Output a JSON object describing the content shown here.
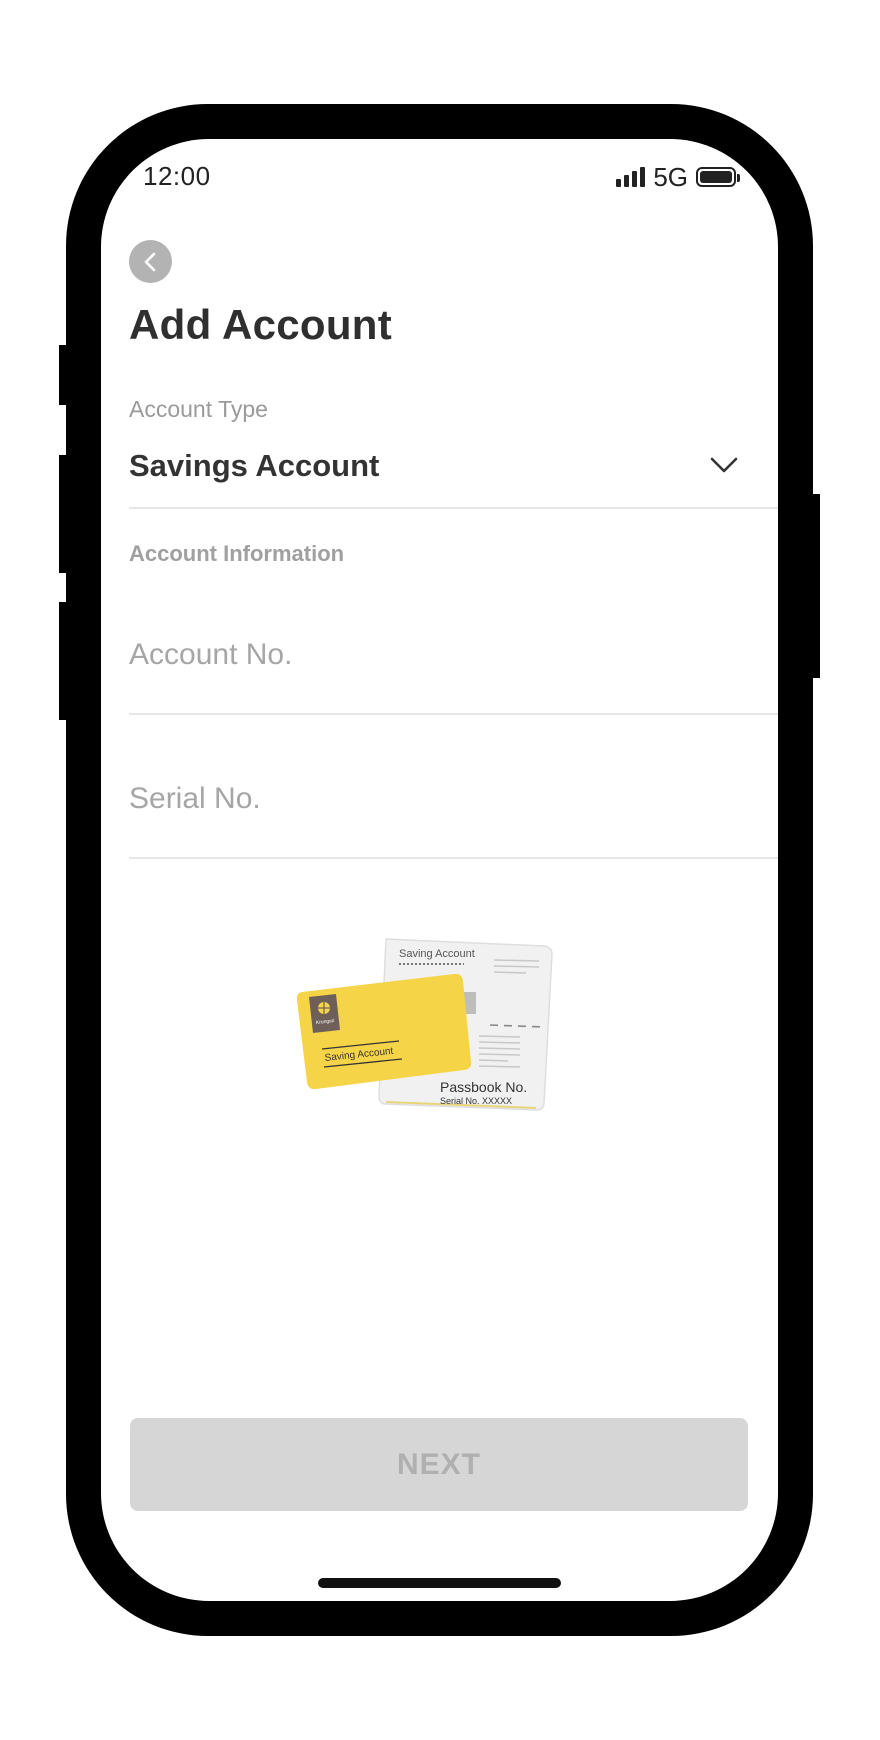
{
  "status_bar": {
    "time": "12:00",
    "network": "5G"
  },
  "header": {
    "title": "Add Account"
  },
  "account_type": {
    "label": "Account Type",
    "value": "Savings Account"
  },
  "account_info": {
    "heading": "Account Information",
    "account_no_placeholder": "Account No.",
    "serial_no_placeholder": "Serial No."
  },
  "illustration": {
    "card_label": "Saving Account",
    "passbook_title": "Saving Account",
    "passbook_no_label": "Passbook No.",
    "serial_label": "Serial No. XXXXX",
    "brand_mark": "Krungsri"
  },
  "footer": {
    "next_label": "NEXT"
  },
  "colors": {
    "card_yellow": "#f6d448",
    "brand_brown": "#6f5f59",
    "button_disabled": "#d6d6d6"
  }
}
